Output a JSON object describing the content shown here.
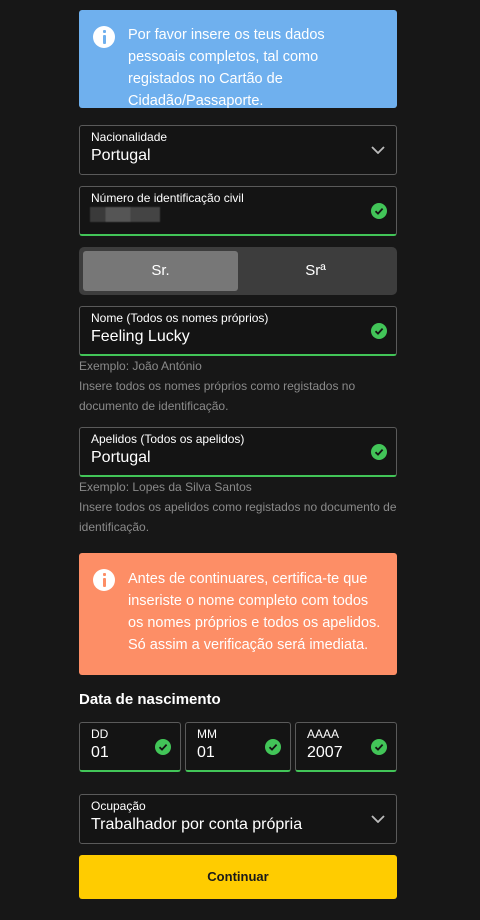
{
  "info_top": {
    "text": "Por favor insere os teus dados pessoais completos, tal como registados no Cartão de Cidadão/Passaporte."
  },
  "nationality": {
    "label": "Nacionalidade",
    "value": "Portugal"
  },
  "civil_id": {
    "label": "Número de identificação civil",
    "value": ""
  },
  "title_toggle": {
    "option_1": "Sr.",
    "option_2": "Srª",
    "selected": "Sr."
  },
  "first_names": {
    "label": "Nome (Todos os nomes próprios)",
    "value": "Feeling Lucky",
    "example": "Exemplo: João António",
    "hint": "Insere todos os nomes próprios como registados no documento de identificação."
  },
  "surnames": {
    "label": "Apelidos (Todos os apelidos)",
    "value": "Portugal",
    "example": "Exemplo: Lopes da Silva Santos",
    "hint": "Insere todos os apelidos como registados no documento de identificação."
  },
  "info_warning": {
    "text": "Antes de continuares, certifica-te que inseriste o nome completo com todos os nomes próprios e todos os apelidos. Só assim a verificação será imediata."
  },
  "birth_date": {
    "title": "Data de nascimento",
    "day": {
      "label": "DD",
      "value": "01"
    },
    "month": {
      "label": "MM",
      "value": "01"
    },
    "year": {
      "label": "AAAA",
      "value": "2007"
    }
  },
  "occupation": {
    "label": "Ocupação",
    "value": "Trabalhador por conta própria"
  },
  "continue_button": "Continuar",
  "colors": {
    "background": "#171717",
    "info_blue": "#6fb0ee",
    "info_orange": "#fd8e66",
    "valid_green": "#42c558",
    "button_yellow": "#ffcc00"
  }
}
